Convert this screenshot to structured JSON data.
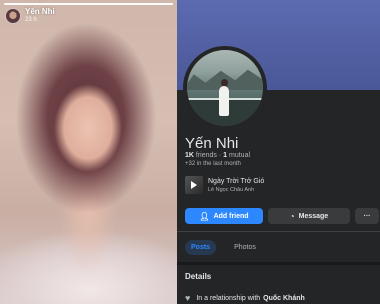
{
  "story": {
    "user_name": "Yến Nhi",
    "time": "23 h",
    "progress_fraction": 1.0
  },
  "profile": {
    "name": "Yến Nhi",
    "friends_count": "1K",
    "friends_label": "friends",
    "mutual_count": "1",
    "mutual_label": "mutual",
    "recent": "+32 in the last month",
    "song": {
      "title": "Ngày Trời Trở Gió",
      "artist": "Lê Ngọc Châu Anh"
    },
    "actions": {
      "add_friend": "Add friend",
      "message": "Message",
      "more": "···"
    },
    "tabs": [
      {
        "label": "Posts",
        "active": true
      },
      {
        "label": "Photos",
        "active": false
      }
    ],
    "details": {
      "title": "Details",
      "relationship_prefix": "In a relationship with",
      "relationship_name": "Quốc Khánh"
    }
  },
  "colors": {
    "accent": "#2d88ff",
    "background": "#242526"
  }
}
